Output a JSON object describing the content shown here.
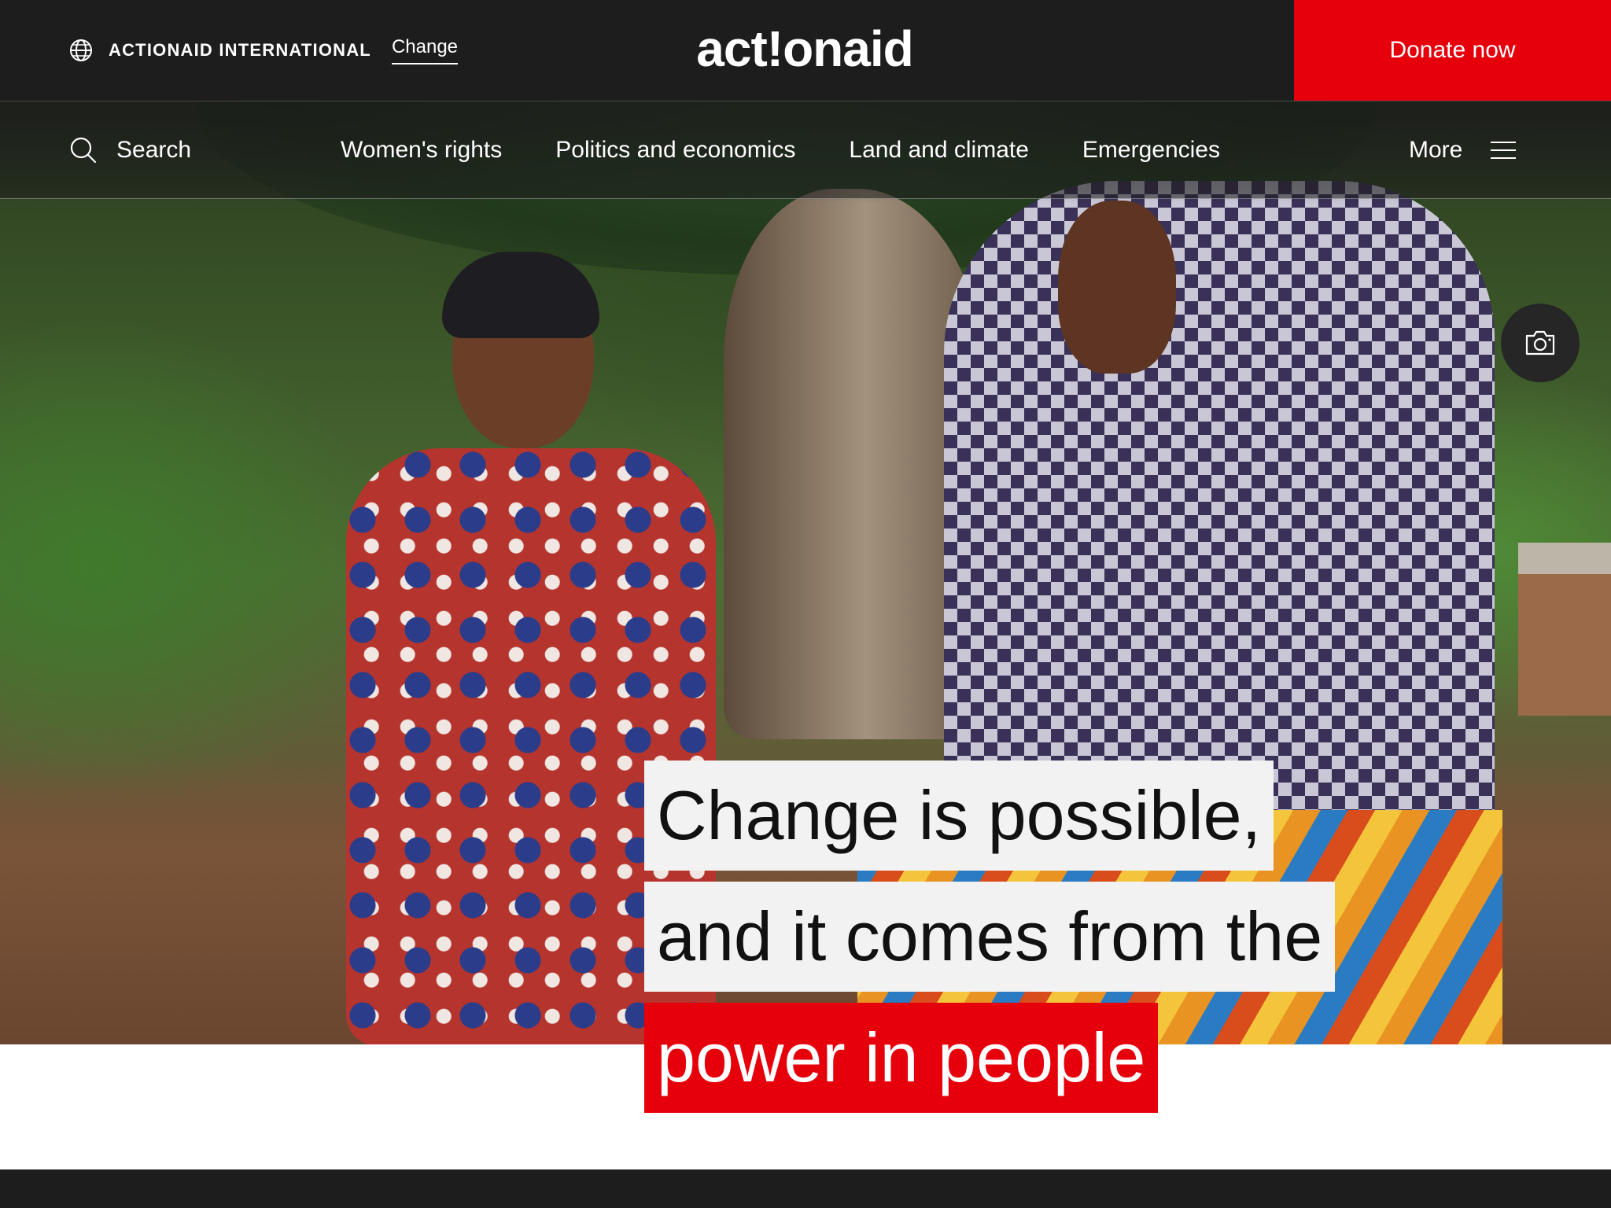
{
  "topbar": {
    "region_name": "ACTIONAID INTERNATIONAL",
    "region_change": "Change",
    "logo": "act!onaid",
    "donate_label": "Donate now"
  },
  "nav": {
    "search_label": "Search",
    "links": [
      "Women's rights",
      "Politics and economics",
      "Land and climate",
      "Emergencies"
    ],
    "more_label": "More"
  },
  "hero": {
    "headline_lines": [
      "Change is possible,",
      "and it comes from the",
      "power in people"
    ]
  },
  "colors": {
    "brand_red": "#e5000b",
    "dark": "#1d1d1d",
    "headline_bg": "#f2f2f2"
  },
  "icons": [
    "globe-icon",
    "search-icon",
    "menu-icon",
    "camera-icon"
  ]
}
